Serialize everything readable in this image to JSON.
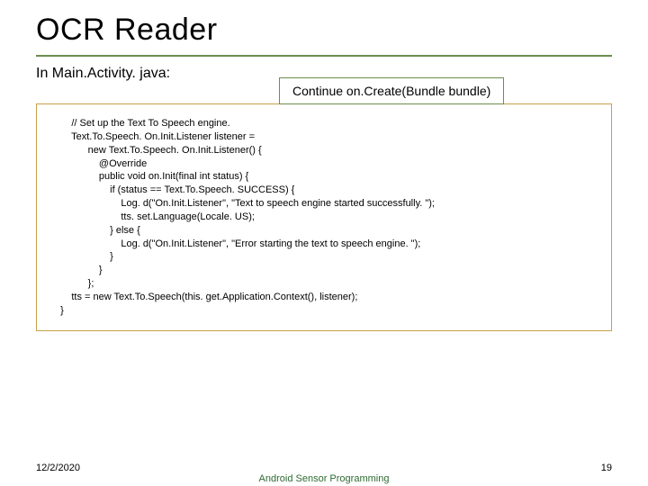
{
  "title": "OCR Reader",
  "context": "In Main.Activity. java:",
  "callout": "Continue on.Create(Bundle bundle)",
  "code": "      // Set up the Text To Speech engine.\n      Text.To.Speech. On.Init.Listener listener =\n            new Text.To.Speech. On.Init.Listener() {\n                @Override\n                public void on.Init(final int status) {\n                    if (status == Text.To.Speech. SUCCESS) {\n                        Log. d(\"On.Init.Listener\", \"Text to speech engine started successfully. \");\n                        tts. set.Language(Locale. US);\n                    } else {\n                        Log. d(\"On.Init.Listener\", \"Error starting the text to speech engine. \");\n                    }\n                }\n            };\n      tts = new Text.To.Speech(this. get.Application.Context(), listener);\n  }",
  "footer": {
    "date": "12/2/2020",
    "center": "Android Sensor Programming",
    "page": "19"
  }
}
